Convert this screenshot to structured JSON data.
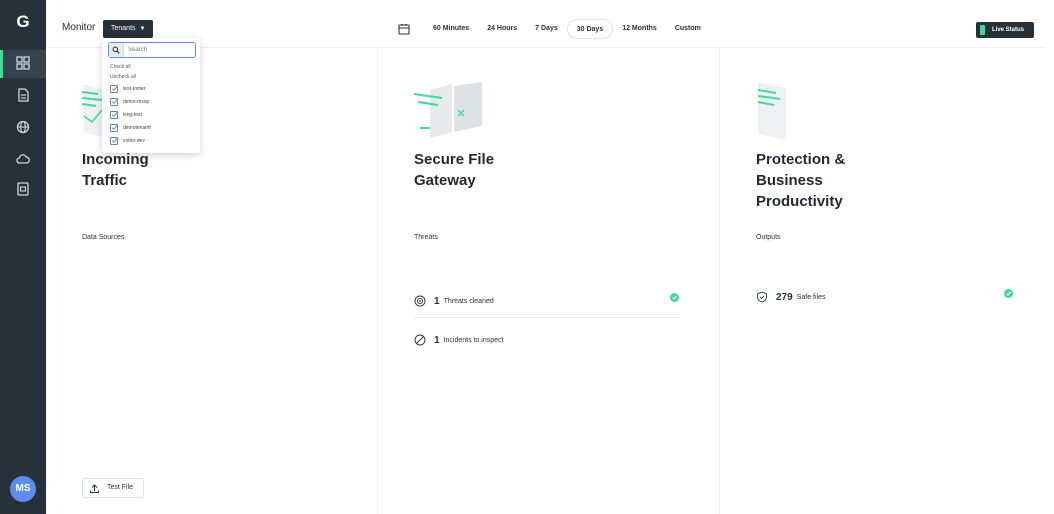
{
  "app": {
    "logo_glyph": "G",
    "page_title": "Monitor",
    "user_initials": "MS",
    "accent_color": "#3ddc97",
    "sidebar_color": "#27313a"
  },
  "sidebar": {
    "icons": [
      "dashboard-icon",
      "document-icon",
      "globe-icon",
      "cloud-icon",
      "report-icon"
    ]
  },
  "header": {
    "tenants_label": "Tenants",
    "time_ranges": [
      "60 Minutes",
      "24 Hours",
      "7 Days",
      "30 Days",
      "12 Months",
      "Custom"
    ],
    "selected_range": "30 Days",
    "live_status_label": "Live Status"
  },
  "tenant_dropdown": {
    "search_placeholder": "Search",
    "check_all": "Check all",
    "uncheck_all": "Uncheck all",
    "tenants": [
      {
        "label": "test-tomer",
        "checked": true
      },
      {
        "label": "demo-mssp",
        "checked": true
      },
      {
        "label": "king-test",
        "checked": true
      },
      {
        "label": "demotenantf",
        "checked": true
      },
      {
        "label": "votiro-dev",
        "checked": true
      }
    ]
  },
  "panels": [
    {
      "title_line1": "Incoming",
      "title_line2": "Traffic",
      "title_line3": "",
      "section": "Data Sources"
    },
    {
      "title_line1": "Secure File",
      "title_line2": "Gateway",
      "title_line3": "",
      "section": "Threats"
    },
    {
      "title_line1": "Protection &",
      "title_line2": "Business",
      "title_line3": "Productivity",
      "section": "Outputs"
    }
  ],
  "metrics": {
    "threats_cleaned_value": "1",
    "threats_cleaned_label": "Threats cleaned",
    "incidents_value": "1",
    "incidents_label": "Incidents to inspect",
    "safe_files_value": "279",
    "safe_files_label": "Safe files"
  },
  "actions": {
    "test_file_label": "Test File"
  }
}
